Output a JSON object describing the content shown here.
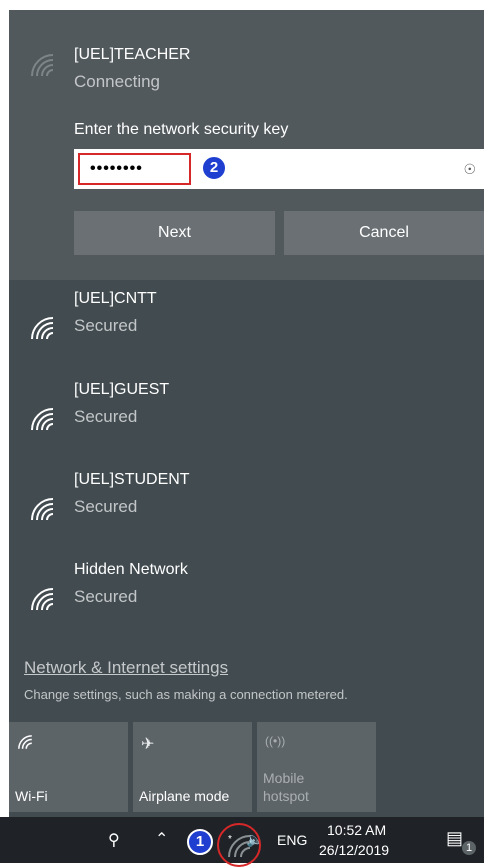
{
  "active_network": {
    "ssid": "[UEL]TEACHER",
    "status": "Connecting",
    "prompt": "Enter the network security key",
    "password_mask": "••••••••",
    "eye_icon": "eye-icon",
    "next_label": "Next",
    "cancel_label": "Cancel"
  },
  "annotations": {
    "badge_1": "1",
    "badge_2": "2"
  },
  "networks": [
    {
      "ssid": "[UEL]CNTT",
      "status": "Secured"
    },
    {
      "ssid": "[UEL]GUEST",
      "status": "Secured"
    },
    {
      "ssid": "[UEL]STUDENT",
      "status": "Secured"
    },
    {
      "ssid": "Hidden Network",
      "status": "Secured"
    }
  ],
  "settings": {
    "link": "Network & Internet settings",
    "description": "Change settings, such as making a connection metered."
  },
  "quick_actions": [
    {
      "label": "Wi-Fi",
      "icon": "wifi-icon"
    },
    {
      "label": "Airplane mode",
      "icon": "airplane-icon"
    },
    {
      "label": "Mobile hotspot",
      "line1": "Mobile",
      "line2": "hotspot",
      "icon": "hotspot-icon"
    }
  ],
  "taskbar": {
    "language": "ENG",
    "time": "10:52 AM",
    "date": "26/12/2019",
    "notification_count": "1"
  },
  "colors": {
    "panel": "#414b50",
    "active_panel": "#52595d",
    "button": "#6a7074",
    "badge": "#1f3fd1",
    "highlight_red": "#d62828",
    "taskbar": "#1f2327"
  }
}
